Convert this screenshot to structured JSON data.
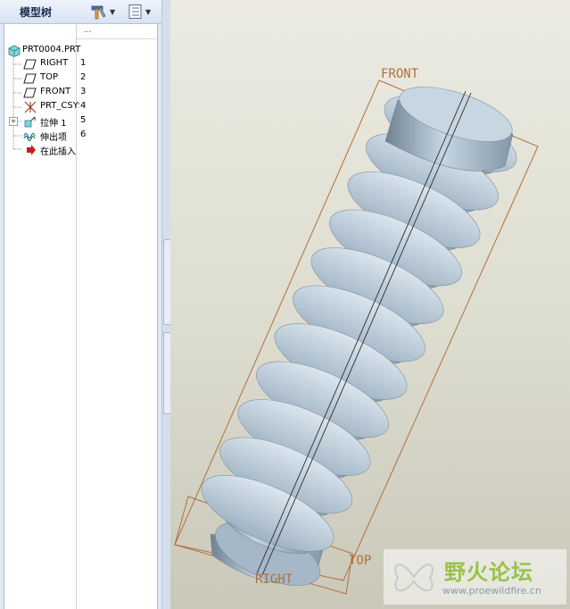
{
  "model_tree": {
    "title": "模型树",
    "column_header": "...",
    "root": "PRT0004.PRT",
    "items": [
      {
        "label": "RIGHT",
        "num": "1",
        "icon": "datum-plane-icon"
      },
      {
        "label": "TOP",
        "num": "2",
        "icon": "datum-plane-icon"
      },
      {
        "label": "FRONT",
        "num": "3",
        "icon": "datum-plane-icon"
      },
      {
        "label": "PRT_CSYS",
        "num": "4",
        "icon": "coordinate-system-icon"
      },
      {
        "label": "拉伸 1",
        "num": "5",
        "icon": "extrude-icon"
      },
      {
        "label": "伸出项",
        "num": "6",
        "icon": "protrusion-icon"
      },
      {
        "label": "在此插入",
        "num": "",
        "icon": "insert-here-icon"
      }
    ]
  },
  "viewport": {
    "plane_labels": {
      "front": "FRONT",
      "top": "TOP",
      "right": "RIGHT"
    },
    "plane_color": "#b0703a",
    "model_color": "#b4c6d6"
  },
  "watermark": {
    "text": "野火论坛",
    "url": "www.proewildfire.cn"
  }
}
